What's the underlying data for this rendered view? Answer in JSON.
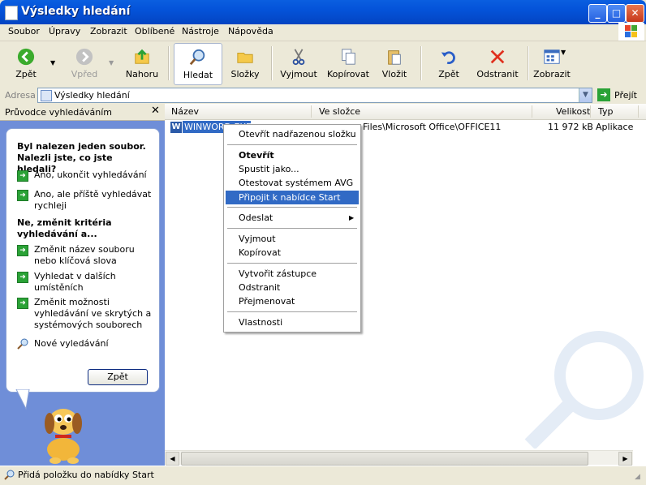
{
  "window": {
    "title": "Výsledky hledání",
    "min": "_",
    "max": "□",
    "close": "✕"
  },
  "menu": [
    "Soubor",
    "Úpravy",
    "Zobrazit",
    "Oblíbené",
    "Nástroje",
    "Nápověda"
  ],
  "toolbar": {
    "back": "Zpět",
    "forward": "Vpřed",
    "up": "Nahoru",
    "search": "Hledat",
    "folders": "Složky",
    "cut": "Vyjmout",
    "copy": "Kopírovat",
    "paste": "Vložit",
    "undo": "Zpět",
    "delete": "Odstranit",
    "views": "Zobrazit"
  },
  "address": {
    "label": "Adresa",
    "value": "Výsledky hledání",
    "go": "Přejít"
  },
  "left_pane": {
    "title": "Průvodce vyhledáváním",
    "heading1": "Byl nalezen jeden soubor. Nalezli jste, co jste hledali?",
    "opt1": "Ano, ukončit vyhledávání",
    "opt2": "Ano, ale příště vyhledávat rychleji",
    "heading2": "Ne, změnit kritéria vyhledávání a...",
    "opt3": "Změnit název souboru nebo klíčová slova",
    "opt4": "Vyhledat v dalších umístěních",
    "opt5": "Změnit možnosti vyhledávání ve skrytých a systémových souborech",
    "new_search": "Nové vyledávání",
    "back_button": "Zpět"
  },
  "columns": {
    "name": "Název",
    "folder": "Ve složce",
    "size": "Velikost",
    "type": "Typ"
  },
  "file": {
    "name": "WINWORD.EXE",
    "folder": "Files\\Microsoft Office\\OFFICE11",
    "size": "11 972 kB",
    "type": "Aplikace"
  },
  "context_menu": {
    "open_parent": "Otevřít nadřazenou složku",
    "open": "Otevřít",
    "run_as": "Spustit jako...",
    "scan_avg": "Otestovat systémem AVG",
    "pin_start": "Připojit k nabídce Start",
    "send_to": "Odeslat",
    "cut": "Vyjmout",
    "copy": "Kopírovat",
    "create_shortcut": "Vytvořit zástupce",
    "delete": "Odstranit",
    "rename": "Přejmenovat",
    "properties": "Vlastnosti"
  },
  "status": {
    "text": "Přidá položku do nabídky Start"
  },
  "colors": {
    "titlebar": "#0453D9",
    "selection": "#316AC5",
    "pane": "#6F8ED8"
  }
}
